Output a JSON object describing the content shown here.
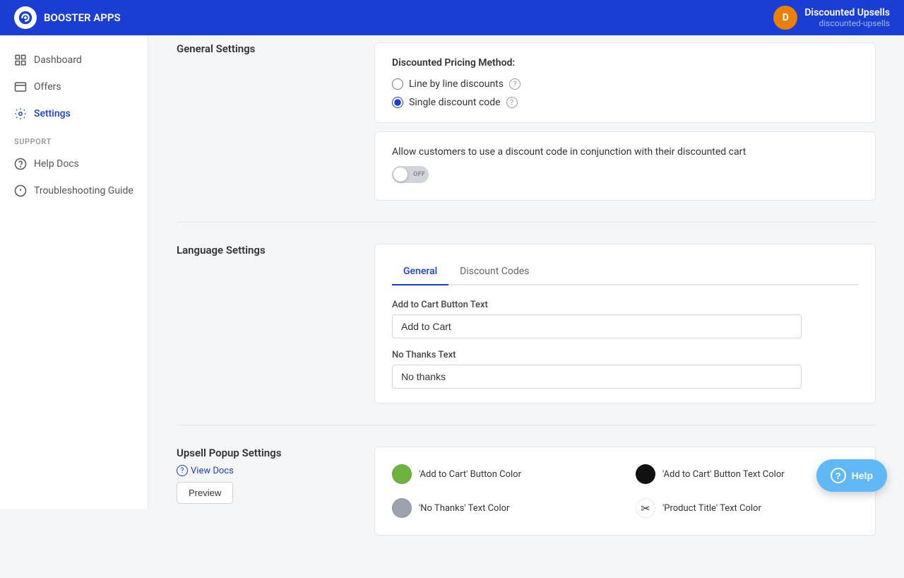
{
  "header": {
    "brand": "BOOSTER APPS",
    "avatar_initial": "D",
    "account_name": "Discounted Upsells",
    "account_sub": "discounted-upsells"
  },
  "sidebar": {
    "items": [
      {
        "id": "dashboard",
        "label": "Dashboard",
        "active": false
      },
      {
        "id": "offers",
        "label": "Offers",
        "active": false
      },
      {
        "id": "settings",
        "label": "Settings",
        "active": true
      }
    ],
    "support_label": "SUPPORT",
    "support_items": [
      {
        "id": "help-docs",
        "label": "Help Docs"
      },
      {
        "id": "troubleshooting",
        "label": "Troubleshooting Guide"
      }
    ]
  },
  "general_settings": {
    "section_title": "General Settings",
    "pricing_card": {
      "title": "Discounted Pricing Method:",
      "options": [
        {
          "id": "line-by-line",
          "label": "Line by line discounts",
          "checked": false
        },
        {
          "id": "single-discount",
          "label": "Single discount code",
          "checked": true
        }
      ]
    },
    "conjunction_card": {
      "text": "Allow customers to use a discount code in conjunction with their discounted cart",
      "toggle_label": "OFF"
    }
  },
  "language_settings": {
    "section_title": "Language Settings",
    "tabs": [
      {
        "id": "general",
        "label": "General",
        "active": true
      },
      {
        "id": "discount-codes",
        "label": "Discount Codes",
        "active": false
      }
    ],
    "fields": [
      {
        "id": "add-to-cart-text",
        "label": "Add to Cart Button Text",
        "value": "Add to Cart"
      },
      {
        "id": "no-thanks-text",
        "label": "No Thanks Text",
        "value": "No thanks"
      }
    ]
  },
  "upsell_popup": {
    "section_title": "Upsell Popup Settings",
    "view_docs_label": "View Docs",
    "preview_label": "Preview",
    "colors": [
      {
        "id": "add-to-cart-btn-color",
        "swatch": "green",
        "label": "'Add to Cart' Button Color"
      },
      {
        "id": "add-to-cart-text-color",
        "swatch": "black",
        "label": "'Add to Cart' Button Text Color"
      },
      {
        "id": "no-thanks-text-color",
        "swatch": "gray",
        "label": "'No Thanks' Text Color"
      },
      {
        "id": "product-title-text-color",
        "swatch": "scissors",
        "label": "'Product Title' Text Color"
      }
    ]
  },
  "help_button": {
    "label": "Help"
  }
}
